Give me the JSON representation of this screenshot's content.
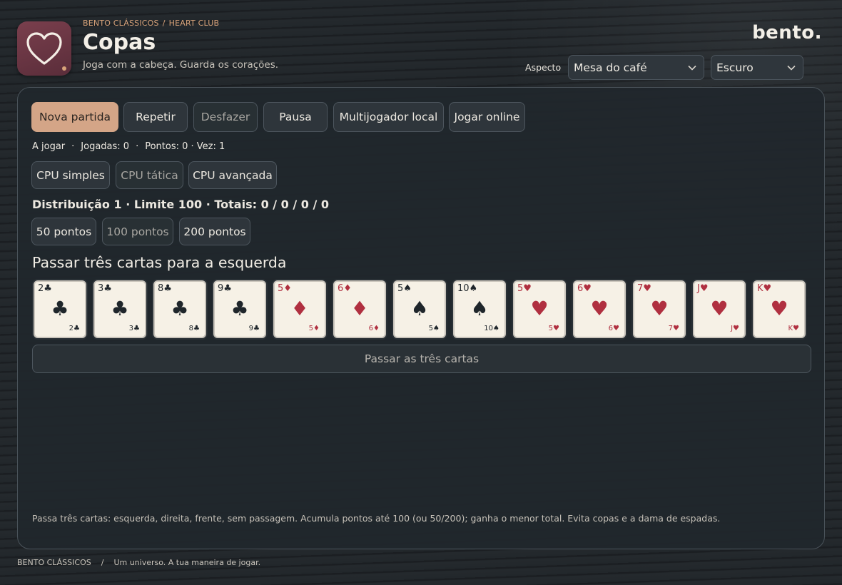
{
  "header": {
    "breadcrumb": [
      "BENTO CLÁSSICOS",
      "HEART CLUB"
    ],
    "breadcrumb_separator": "/",
    "title": "Copas",
    "subtitle": "Joga com a cabeça. Guarda os corações.",
    "brand": "bento.",
    "aspect_label": "Aspecto",
    "theme_select": "Mesa do café",
    "mode_select": "Escuro",
    "app_icon": "heart-icon"
  },
  "toolbar": {
    "new_game": "Nova partida",
    "repeat": "Repetir",
    "undo": "Desfazer",
    "pause": "Pausa",
    "local_multiplayer": "Multijogador local",
    "online": "Jogar online"
  },
  "status": {
    "state": "A jogar",
    "moves": "Jogadas: 0",
    "points": "Pontos: 0 · Vez: 1",
    "separator": "·"
  },
  "cpu": {
    "simple": "CPU simples",
    "tactical": "CPU tática",
    "advanced": "CPU avançada"
  },
  "round_info": "Distribuição 1 · Limite 100 · Totais: 0 / 0 / 0 / 0",
  "limits": {
    "p50": "50 pontos",
    "p100": "100 pontos",
    "p200": "200 pontos"
  },
  "pass_title": "Passar três cartas para a esquerda",
  "hand": [
    {
      "rank": "2",
      "suit": "♣",
      "color": "black"
    },
    {
      "rank": "3",
      "suit": "♣",
      "color": "black"
    },
    {
      "rank": "8",
      "suit": "♣",
      "color": "black"
    },
    {
      "rank": "9",
      "suit": "♣",
      "color": "black"
    },
    {
      "rank": "5",
      "suit": "♦",
      "color": "red"
    },
    {
      "rank": "6",
      "suit": "♦",
      "color": "red"
    },
    {
      "rank": "5",
      "suit": "♠",
      "color": "black"
    },
    {
      "rank": "10",
      "suit": "♠",
      "color": "black"
    },
    {
      "rank": "5",
      "suit": "♥",
      "color": "red"
    },
    {
      "rank": "6",
      "suit": "♥",
      "color": "red"
    },
    {
      "rank": "7",
      "suit": "♥",
      "color": "red"
    },
    {
      "rank": "J",
      "suit": "♥",
      "color": "red"
    },
    {
      "rank": "K",
      "suit": "♥",
      "color": "red"
    }
  ],
  "pass_button": "Passar as três cartas",
  "rules": "Passa três cartas: esquerda, direita, frente, sem passagem. Acumula pontos até 100 (ou 50/200); ganha o menor total. Evita copas e a dama de espadas.",
  "footer": {
    "brand": "BENTO CLÁSSICOS",
    "separator": "/",
    "tagline": "Um universo. A tua maneira de jogar."
  },
  "colors": {
    "accent": "#d4a587",
    "breadcrumb": "#d8a37a",
    "icon_bg": "#6b3544",
    "card_red": "#b03040",
    "card_black": "#1f262b"
  }
}
